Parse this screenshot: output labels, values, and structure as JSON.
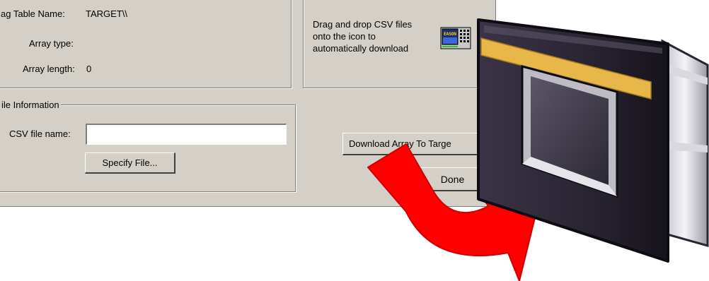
{
  "tag_table": {
    "name_label": "ag Table Name:",
    "name_value": "TARGET\\\\",
    "array_type_label": "Array type:",
    "array_type_value": "",
    "array_length_label": "Array length:",
    "array_length_value": "0"
  },
  "drag_drop": {
    "instruction_line1": "Drag and drop CSV files",
    "instruction_line2": "onto the icon to",
    "instruction_line3": "automatically download",
    "icon_text": "EASON"
  },
  "file_info": {
    "legend": "ile Information",
    "csv_label": "CSV file name:",
    "csv_value": "",
    "specify_button": "Specify File..."
  },
  "actions": {
    "download_button": "Download Array To Targe",
    "done_button": "Done"
  },
  "colors": {
    "dialog_bg": "#d4d0c8",
    "arrow": "#ff0000",
    "device_body": "#2d2836",
    "device_strip": "#e8b74a"
  },
  "icons": {
    "arrow": "curved-arrow-icon",
    "device": "operator-panel-device-icon"
  }
}
